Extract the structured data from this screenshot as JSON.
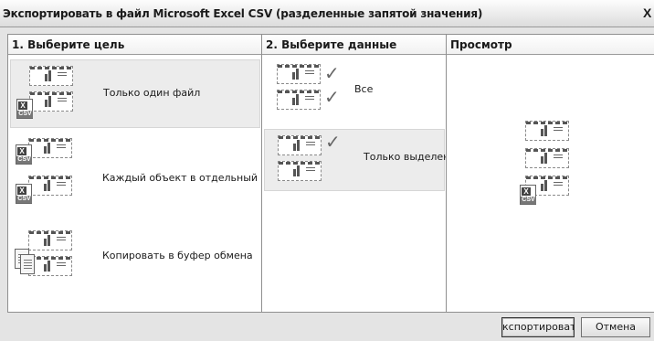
{
  "window": {
    "title": "Экспортировать в файл Microsoft Excel CSV (разделенные запятой значения)",
    "close_glyph": "X"
  },
  "target_column": {
    "header": "1. Выберите цель",
    "options": [
      {
        "label": "Только один файл",
        "icon": "single-csv-file-icon",
        "selected": true
      },
      {
        "label": "Каждый объект в отдельный ф",
        "icon": "multiple-csv-files-icon",
        "selected": false
      },
      {
        "label": "Копировать в буфер обмена",
        "icon": "clipboard-icon",
        "selected": false
      }
    ]
  },
  "data_column": {
    "header": "2. Выберите данные",
    "options": [
      {
        "label": "Все",
        "icon": "all-tables-checked-icon",
        "selected": false
      },
      {
        "label": "Только выделенн",
        "icon": "selected-table-checked-icon",
        "selected": true
      }
    ]
  },
  "preview_column": {
    "header": "Просмотр",
    "icon": "preview-csv-icon"
  },
  "buttons": {
    "export_label": "кспортироват",
    "cancel_label": "Отмена"
  },
  "icon_glyphs": {
    "excel_mark": "X",
    "csv_mark": "CSV"
  }
}
